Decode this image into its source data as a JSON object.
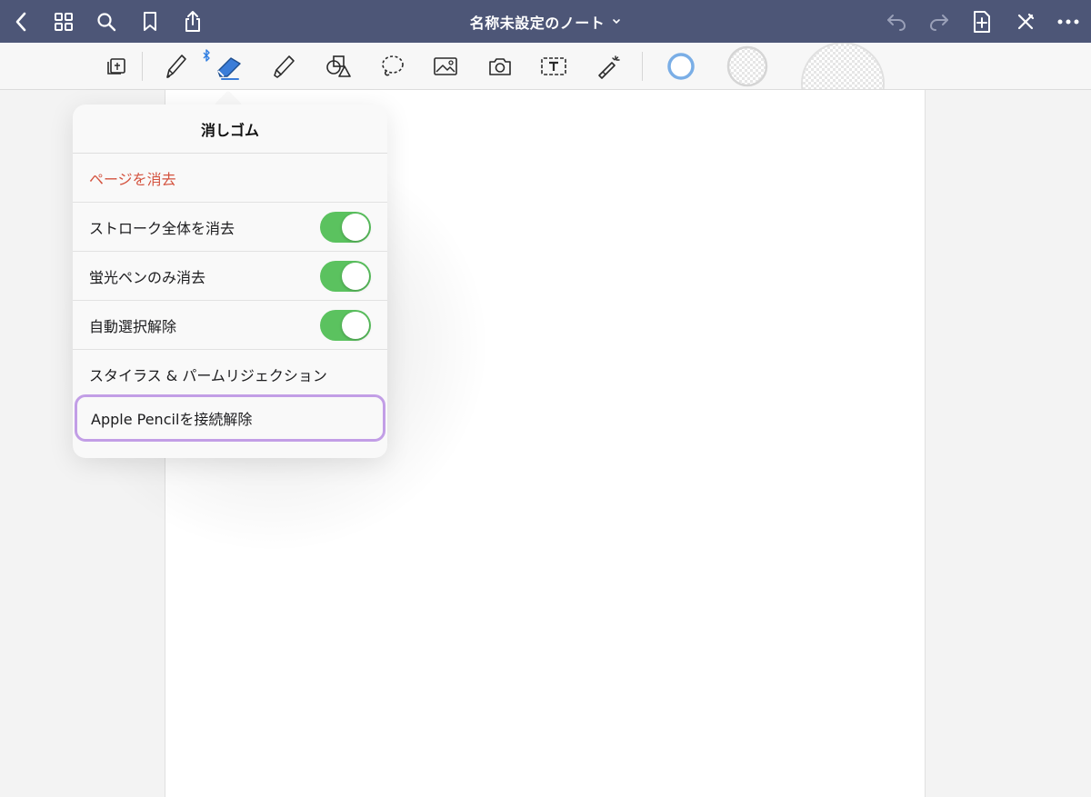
{
  "nav": {
    "title": "名称未設定のノート",
    "icons": {
      "back": "chevron-left-icon",
      "grid": "grid-icon",
      "search": "search-icon",
      "bookmark": "bookmark-icon",
      "share": "share-icon",
      "title_menu": "chevron-down-icon",
      "undo": "undo-icon",
      "redo": "redo-icon",
      "add_page": "add-page-icon",
      "close_editing": "close-icon",
      "more": "more-icon"
    }
  },
  "toolbar": {
    "tools": [
      "read-only-mode-icon",
      "pen-icon",
      "eraser-icon",
      "highlighter-icon",
      "shapes-icon",
      "lasso-icon",
      "image-icon",
      "camera-icon",
      "text-box-icon",
      "laser-pointer-icon"
    ],
    "selected_tool": "eraser",
    "bluetooth_indicator": "bluetooth-icon",
    "sizes": [
      "small",
      "medium",
      "large"
    ],
    "colors": {
      "eraser_active": "#3b7dd8",
      "size_small_ring": "#7aaee6"
    }
  },
  "popover": {
    "title": "消しゴム",
    "clear_page": "ページを消去",
    "options": [
      {
        "label": "ストローク全体を消去",
        "on": true
      },
      {
        "label": "蛍光ペンのみ消去",
        "on": true
      },
      {
        "label": "自動選択解除",
        "on": true
      }
    ],
    "stylus_palm": "スタイラス & パームリジェクション",
    "disconnect_pencil": "Apple Pencilを接続解除",
    "colors": {
      "toggle_on": "#5bc25f",
      "destructive": "#d4533f",
      "highlight_outline": "#c29ee6"
    }
  },
  "theme": {
    "nav_bg": "#4d5677",
    "toolbar_bg": "#f7f7f7",
    "canvas_bg": "#f3f3f3",
    "page_bg": "#ffffff"
  }
}
